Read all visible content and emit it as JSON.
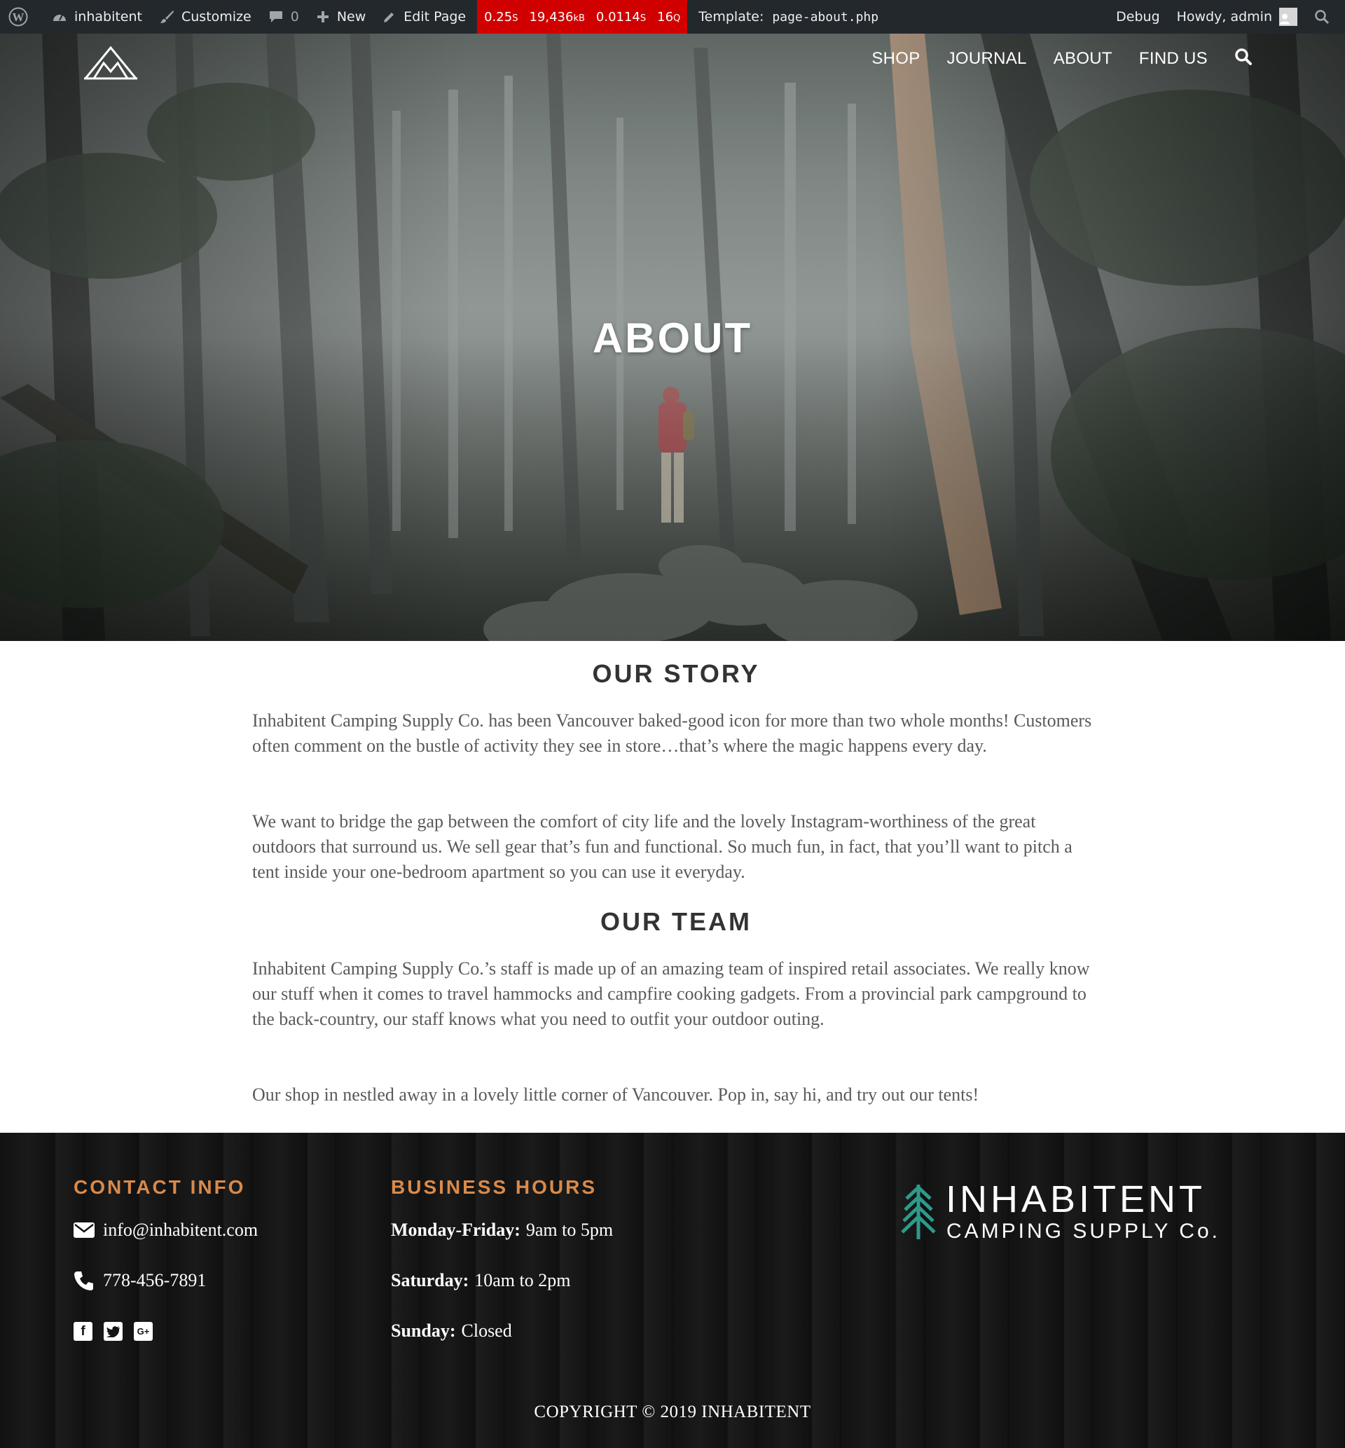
{
  "admin_bar": {
    "site_name": "inhabitent",
    "customize": "Customize",
    "comments_count": "0",
    "new": "New",
    "edit_page": "Edit Page",
    "perf": {
      "time": "0.25",
      "time_unit": "S",
      "memory": "19,436",
      "memory_unit": "kB",
      "query_time": "0.0114",
      "query_time_unit": "S",
      "queries": "16",
      "queries_unit": "Q"
    },
    "template_label": "Template:",
    "template_file": "page-about.php",
    "debug": "Debug",
    "howdy": "Howdy, admin"
  },
  "nav": {
    "items": [
      {
        "label": "SHOP"
      },
      {
        "label": "JOURNAL"
      },
      {
        "label": "ABOUT"
      },
      {
        "label": "FIND US"
      }
    ]
  },
  "hero": {
    "title": "ABOUT"
  },
  "content": {
    "story_heading": "OUR STORY",
    "story_p1": "Inhabitent Camping Supply Co. has been Vancouver baked-good icon for more than two whole months! Customers often comment on the bustle of activity they see in store…that’s where the magic happens every day.",
    "story_p2": "We want to bridge the gap between the comfort of city life and the lovely Instagram-worthiness of the great outdoors that surround us. We sell gear that’s fun and functional. So much fun, in fact, that you’ll want to pitch a tent inside your one-bedroom apartment so you can use it everyday.",
    "team_heading": "OUR TEAM",
    "team_p1": "Inhabitent Camping Supply Co.’s staff is made up of an amazing team of inspired retail associates. We really know our stuff when it comes to travel hammocks and campfire cooking gadgets. From a provincial park campground to the back-country, our staff knows what you need to outfit your outdoor outing.",
    "team_p2": "Our shop in nestled away in a lovely little corner of Vancouver. Pop in, say hi, and try out our tents!"
  },
  "footer": {
    "contact_heading": "CONTACT INFO",
    "email": "info@inhabitent.com",
    "phone": "778-456-7891",
    "social": [
      {
        "icon": "facebook-icon"
      },
      {
        "icon": "twitter-icon"
      },
      {
        "icon": "google-plus-icon",
        "glyph": "G+"
      }
    ],
    "hours_heading": "BUSINESS HOURS",
    "hours": [
      {
        "day": "Monday-Friday:",
        "time": "9am to 5pm"
      },
      {
        "day": "Saturday:",
        "time": "10am to 2pm"
      },
      {
        "day": "Sunday:",
        "time": "Closed"
      }
    ],
    "brand_name": "INHABITENT",
    "brand_sub": "CAMPING SUPPLY Co.",
    "copyright": "COPYRIGHT © 2019 INHABITENT"
  },
  "colors": {
    "admin_bar_bg": "#23282d",
    "perf_bg": "#d10000",
    "footer_heading": "#d98a4a",
    "brand_tree": "#2f9a8a",
    "footer_bg": "#141414"
  }
}
